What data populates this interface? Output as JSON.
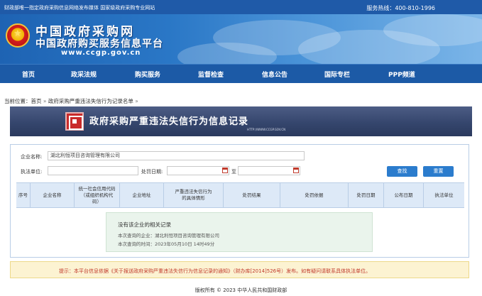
{
  "topbar": {
    "left_text": "财政部唯一指定政府采购信息网络发布媒体 国家级政府采购专业网站",
    "hotline": "服务热线：400-810-1996"
  },
  "banner": {
    "title_line1": "中国政府采购网",
    "title_line2": "中国政府购买服务信息平台",
    "url": "www.ccgp.gov.cn"
  },
  "nav": {
    "items": [
      "首页",
      "政采法规",
      "购买服务",
      "监督检查",
      "信息公告",
      "国际专栏",
      "PPP频道"
    ]
  },
  "breadcrumb": {
    "prefix": "当前位置：",
    "home": "首页",
    "separator": "»",
    "current": "政府采购严重违法失信行为记录名单",
    "trailing": "»"
  },
  "header_banner": {
    "title": "政府采购严重违法失信行为信息记录",
    "url": "HTTP://WWW.CCGP.GOV.CN"
  },
  "search": {
    "company_label": "企业名称:",
    "company_value": "湖北利恒项目咨询管理有限公司",
    "unit_label": "执法单位:",
    "unit_value": "",
    "date_label": "处罚日期:",
    "date_from": "",
    "date_to_label": "至",
    "date_to": "",
    "search_button": "查找",
    "reset_button": "重置"
  },
  "table": {
    "headers": [
      "序号",
      "企业名称",
      "统一社会信用代码（或组织机构代码）",
      "企业地址",
      "严重违法失信行为的具体情形",
      "处罚结果",
      "处罚依据",
      "处罚日期",
      "公布日期",
      "执法单位"
    ]
  },
  "result": {
    "empty_title": "没有该企业的相关记录",
    "query_company": "本次查询的企业：湖北利恒项目咨询管理有限公司",
    "query_time": "本次查询的时间：2023年05月10日 14时49分"
  },
  "notice": {
    "text": "提示：本平台信息依据《关于报送政府采购严重违法失信行为信息记录的通知》（财办库[2014]526号）发布。如有疑问请联系具体执法单位。"
  },
  "footer": {
    "copyright": "版权所有 © 2023 中华人民共和国财政部"
  },
  "colors": {
    "nav_blue": "#1c5aa6",
    "accent_button": "#2b7ccd",
    "notice_text": "#c0392b"
  }
}
